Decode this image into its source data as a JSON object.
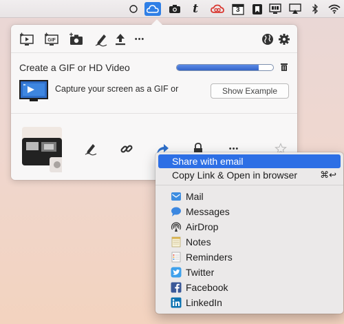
{
  "menubar": {
    "icons": [
      "circle-icon",
      "cloudapp-icon",
      "camera-icon",
      "tumblr-icon",
      "creative-cloud-icon",
      "calendar-icon",
      "bookmark-icon",
      "display-icon",
      "airplay-icon",
      "bluetooth-icon",
      "wifi-icon"
    ],
    "calendar_day": "3",
    "accent": "#2f7fe6"
  },
  "toolbar": {
    "more_label": "•••"
  },
  "create": {
    "title": "Create a GIF or HD Video",
    "progress": 0.85
  },
  "capture": {
    "text": "Capture your screen as a GIF or",
    "button": "Show Example"
  },
  "actions": {
    "more_label": "•••"
  },
  "context_menu": {
    "highlight_color": "#2d6fe5",
    "items": [
      {
        "label": "Share with email",
        "highlighted": true
      },
      {
        "label": "Copy Link & Open in browser",
        "shortcut": "⌘↩"
      }
    ],
    "services": [
      {
        "label": "Mail",
        "icon": "mail-icon"
      },
      {
        "label": "Messages",
        "icon": "messages-icon"
      },
      {
        "label": "AirDrop",
        "icon": "airdrop-icon"
      },
      {
        "label": "Notes",
        "icon": "notes-icon"
      },
      {
        "label": "Reminders",
        "icon": "reminders-icon"
      },
      {
        "label": "Twitter",
        "icon": "twitter-icon"
      },
      {
        "label": "Facebook",
        "icon": "facebook-icon"
      },
      {
        "label": "LinkedIn",
        "icon": "linkedin-icon"
      }
    ]
  }
}
